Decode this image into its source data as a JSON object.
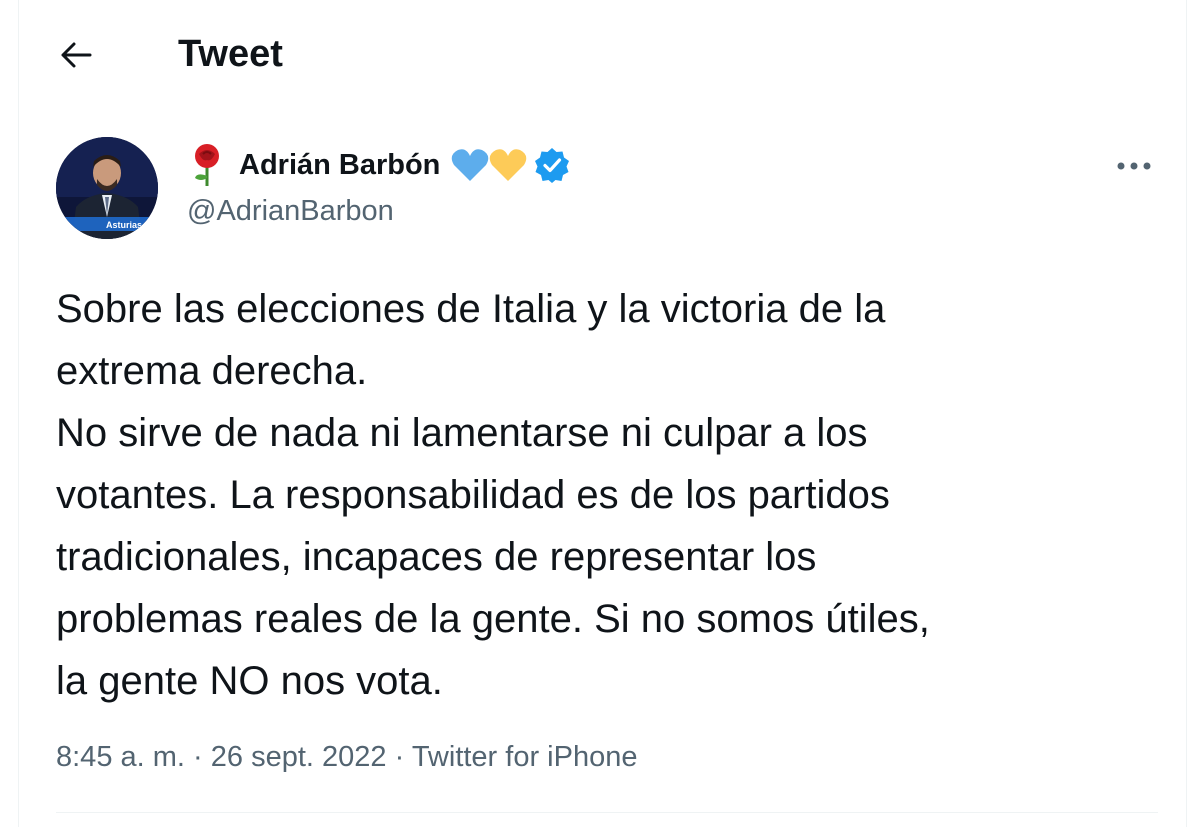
{
  "header": {
    "title": "Tweet",
    "back_icon": "arrow-left-icon"
  },
  "author": {
    "avatar_badge": "Asturias",
    "emoji_icon": "rose-icon",
    "display_name": "Adrián Barbón",
    "badges": [
      "blue-heart-icon",
      "yellow-heart-icon",
      "verified-badge-icon"
    ],
    "handle": "@AdrianBarbon",
    "more_icon": "more-horizontal-icon"
  },
  "tweet": {
    "lines": [
      "Sobre las elecciones de Italia y la victoria de la",
      "extrema derecha.",
      "No sirve de nada ni lamentarse ni culpar a los",
      "votantes. La responsabilidad es de los partidos",
      "tradicionales, incapaces de representar los",
      "problemas reales de la gente. Si no somos útiles,",
      "la gente NO nos vota."
    ]
  },
  "meta": {
    "time": "8:45 a. m.",
    "separator": "·",
    "date": "26 sept. 2022",
    "source": "Twitter for iPhone"
  },
  "colors": {
    "text": "#0f1419",
    "secondary": "#536471",
    "verified": "#1d9bf0",
    "blue_heart": "#5dadec",
    "yellow_heart": "#fdcb58",
    "divider": "#eff3f4"
  }
}
